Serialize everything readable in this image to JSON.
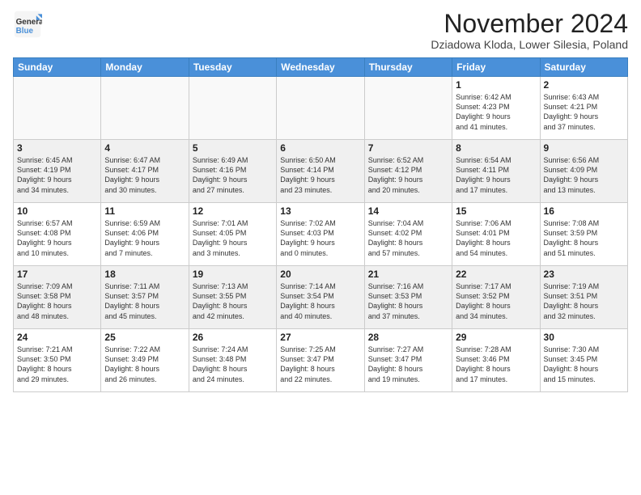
{
  "header": {
    "logo_general": "General",
    "logo_blue": "Blue",
    "month_title": "November 2024",
    "subtitle": "Dziadowa Kloda, Lower Silesia, Poland"
  },
  "days_of_week": [
    "Sunday",
    "Monday",
    "Tuesday",
    "Wednesday",
    "Thursday",
    "Friday",
    "Saturday"
  ],
  "weeks": [
    [
      {
        "day": "",
        "info": ""
      },
      {
        "day": "",
        "info": ""
      },
      {
        "day": "",
        "info": ""
      },
      {
        "day": "",
        "info": ""
      },
      {
        "day": "",
        "info": ""
      },
      {
        "day": "1",
        "info": "Sunrise: 6:42 AM\nSunset: 4:23 PM\nDaylight: 9 hours\nand 41 minutes."
      },
      {
        "day": "2",
        "info": "Sunrise: 6:43 AM\nSunset: 4:21 PM\nDaylight: 9 hours\nand 37 minutes."
      }
    ],
    [
      {
        "day": "3",
        "info": "Sunrise: 6:45 AM\nSunset: 4:19 PM\nDaylight: 9 hours\nand 34 minutes."
      },
      {
        "day": "4",
        "info": "Sunrise: 6:47 AM\nSunset: 4:17 PM\nDaylight: 9 hours\nand 30 minutes."
      },
      {
        "day": "5",
        "info": "Sunrise: 6:49 AM\nSunset: 4:16 PM\nDaylight: 9 hours\nand 27 minutes."
      },
      {
        "day": "6",
        "info": "Sunrise: 6:50 AM\nSunset: 4:14 PM\nDaylight: 9 hours\nand 23 minutes."
      },
      {
        "day": "7",
        "info": "Sunrise: 6:52 AM\nSunset: 4:12 PM\nDaylight: 9 hours\nand 20 minutes."
      },
      {
        "day": "8",
        "info": "Sunrise: 6:54 AM\nSunset: 4:11 PM\nDaylight: 9 hours\nand 17 minutes."
      },
      {
        "day": "9",
        "info": "Sunrise: 6:56 AM\nSunset: 4:09 PM\nDaylight: 9 hours\nand 13 minutes."
      }
    ],
    [
      {
        "day": "10",
        "info": "Sunrise: 6:57 AM\nSunset: 4:08 PM\nDaylight: 9 hours\nand 10 minutes."
      },
      {
        "day": "11",
        "info": "Sunrise: 6:59 AM\nSunset: 4:06 PM\nDaylight: 9 hours\nand 7 minutes."
      },
      {
        "day": "12",
        "info": "Sunrise: 7:01 AM\nSunset: 4:05 PM\nDaylight: 9 hours\nand 3 minutes."
      },
      {
        "day": "13",
        "info": "Sunrise: 7:02 AM\nSunset: 4:03 PM\nDaylight: 9 hours\nand 0 minutes."
      },
      {
        "day": "14",
        "info": "Sunrise: 7:04 AM\nSunset: 4:02 PM\nDaylight: 8 hours\nand 57 minutes."
      },
      {
        "day": "15",
        "info": "Sunrise: 7:06 AM\nSunset: 4:01 PM\nDaylight: 8 hours\nand 54 minutes."
      },
      {
        "day": "16",
        "info": "Sunrise: 7:08 AM\nSunset: 3:59 PM\nDaylight: 8 hours\nand 51 minutes."
      }
    ],
    [
      {
        "day": "17",
        "info": "Sunrise: 7:09 AM\nSunset: 3:58 PM\nDaylight: 8 hours\nand 48 minutes."
      },
      {
        "day": "18",
        "info": "Sunrise: 7:11 AM\nSunset: 3:57 PM\nDaylight: 8 hours\nand 45 minutes."
      },
      {
        "day": "19",
        "info": "Sunrise: 7:13 AM\nSunset: 3:55 PM\nDaylight: 8 hours\nand 42 minutes."
      },
      {
        "day": "20",
        "info": "Sunrise: 7:14 AM\nSunset: 3:54 PM\nDaylight: 8 hours\nand 40 minutes."
      },
      {
        "day": "21",
        "info": "Sunrise: 7:16 AM\nSunset: 3:53 PM\nDaylight: 8 hours\nand 37 minutes."
      },
      {
        "day": "22",
        "info": "Sunrise: 7:17 AM\nSunset: 3:52 PM\nDaylight: 8 hours\nand 34 minutes."
      },
      {
        "day": "23",
        "info": "Sunrise: 7:19 AM\nSunset: 3:51 PM\nDaylight: 8 hours\nand 32 minutes."
      }
    ],
    [
      {
        "day": "24",
        "info": "Sunrise: 7:21 AM\nSunset: 3:50 PM\nDaylight: 8 hours\nand 29 minutes."
      },
      {
        "day": "25",
        "info": "Sunrise: 7:22 AM\nSunset: 3:49 PM\nDaylight: 8 hours\nand 26 minutes."
      },
      {
        "day": "26",
        "info": "Sunrise: 7:24 AM\nSunset: 3:48 PM\nDaylight: 8 hours\nand 24 minutes."
      },
      {
        "day": "27",
        "info": "Sunrise: 7:25 AM\nSunset: 3:47 PM\nDaylight: 8 hours\nand 22 minutes."
      },
      {
        "day": "28",
        "info": "Sunrise: 7:27 AM\nSunset: 3:47 PM\nDaylight: 8 hours\nand 19 minutes."
      },
      {
        "day": "29",
        "info": "Sunrise: 7:28 AM\nSunset: 3:46 PM\nDaylight: 8 hours\nand 17 minutes."
      },
      {
        "day": "30",
        "info": "Sunrise: 7:30 AM\nSunset: 3:45 PM\nDaylight: 8 hours\nand 15 minutes."
      }
    ]
  ]
}
